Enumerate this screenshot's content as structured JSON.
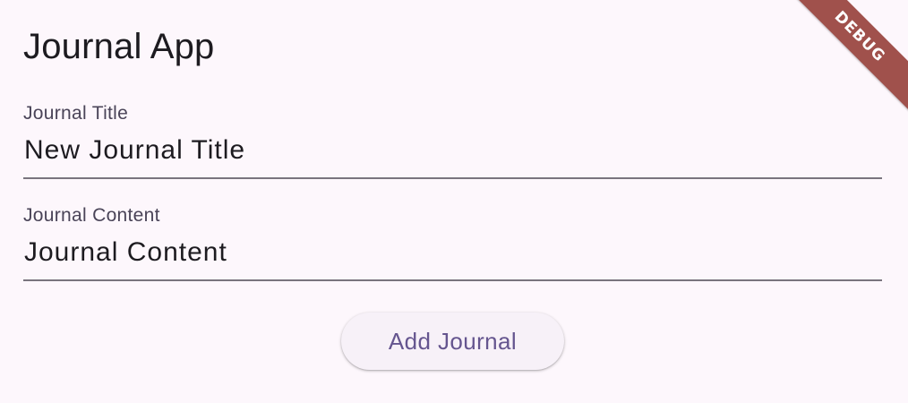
{
  "app_bar": {
    "title": "Journal App"
  },
  "form": {
    "title_field": {
      "label": "Journal Title",
      "value": "New Journal Title"
    },
    "content_field": {
      "label": "Journal Content",
      "value": "Journal Content"
    },
    "submit_label": "Add Journal"
  },
  "debug_banner": {
    "label": "DEBUG",
    "color": "#a0514c"
  },
  "theme": {
    "background": "#fdf7fc",
    "accent": "#65558f"
  }
}
